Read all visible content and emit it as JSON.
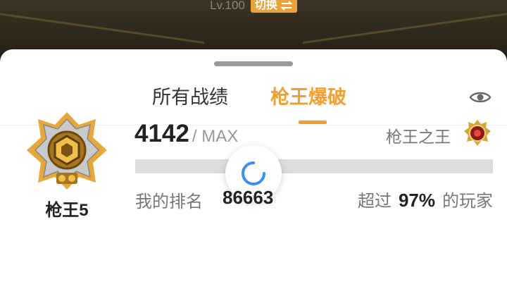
{
  "header": {
    "level": "Lv.100",
    "switch_label": "切换"
  },
  "tabs": [
    {
      "label": "所有战绩",
      "active": false
    },
    {
      "label": "枪王爆破",
      "active": true
    }
  ],
  "rank": {
    "name": "枪王5",
    "score": "4142",
    "max_label": "/ MAX",
    "tier_name": "枪王之王",
    "progress_percent": 100,
    "my_rank_label": "我的排名",
    "my_rank_value": "86663",
    "exceed_prefix": "超过",
    "exceed_value": "97%",
    "exceed_suffix": "的玩家"
  },
  "colors": {
    "accent": "#f0a030",
    "switch_bg": "#e8a43a"
  },
  "icons": {
    "switch": "swap-arrows-icon",
    "eye": "eye-icon",
    "badge": "rank-badge-icon",
    "tier": "tier-emblem-icon",
    "loading": "loading-spinner-icon"
  }
}
